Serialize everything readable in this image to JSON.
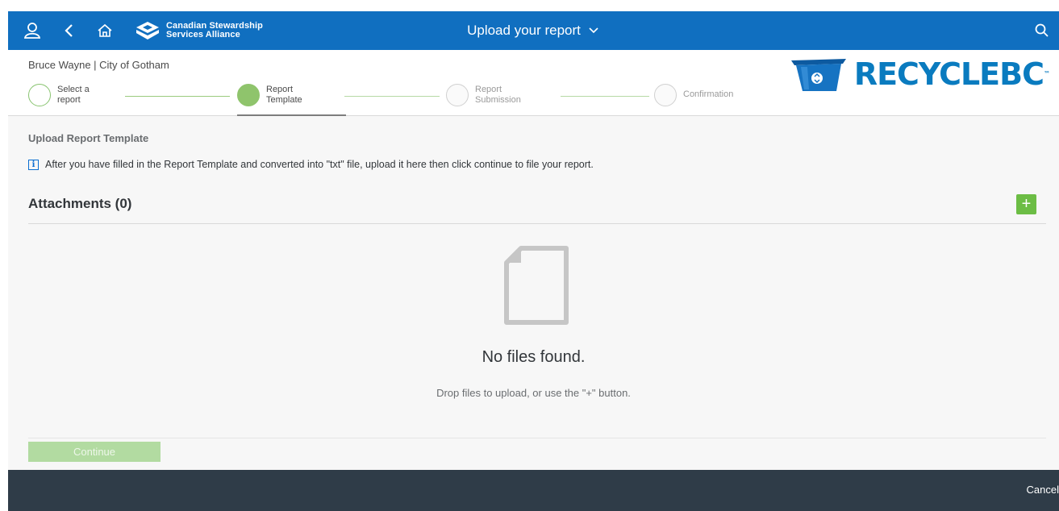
{
  "shellbar": {
    "logo_line1": "Canadian Stewardship",
    "logo_line2": "Services Alliance",
    "title": "Upload your report",
    "icons": [
      "user-icon",
      "back-icon",
      "home-icon",
      "chevron-down-icon",
      "search-icon"
    ]
  },
  "header": {
    "user_line": "Bruce Wayne | City of Gotham",
    "brand": "RECYCLEBC",
    "brand_tm": "™"
  },
  "steps": [
    {
      "line1": "Select a",
      "line2": "report",
      "state": "done"
    },
    {
      "line1": "Report",
      "line2": "Template",
      "state": "active"
    },
    {
      "line1": "Report",
      "line2": "Submission",
      "state": "pending"
    },
    {
      "line1": "Confirmation",
      "line2": "",
      "state": "pending"
    }
  ],
  "content": {
    "section_title": "Upload Report Template",
    "info_icon_glyph": "i",
    "info_text": "After you have filled in the Report Template and converted into \"txt\" file, upload it here then click continue to file your report.",
    "attachments_title": "Attachments (0)",
    "add_label": "+",
    "empty_title": "No files found.",
    "empty_subtitle": "Drop files to upload, or use the \"+\" button."
  },
  "actions": {
    "continue_label": "Continue",
    "cancel_label": "Cancel"
  },
  "colors": {
    "shell": "#106fc0",
    "step_active": "#8fc46c",
    "add_button": "#6cbd45",
    "continue_disabled": "#b2dba1",
    "footer": "#2f3c48",
    "brand_blue": "#0a7bbf"
  }
}
